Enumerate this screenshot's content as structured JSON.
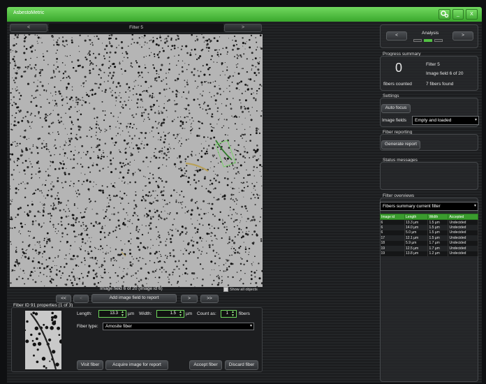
{
  "app": {
    "title": "AsbestoMetric",
    "minimize": "_",
    "close": "X"
  },
  "image_view": {
    "filter_label": "Filter 5",
    "prev": "<",
    "next": ">",
    "field_label": "Image field 6 of 20 (image id 6)",
    "show_all_objects": "Show all objects",
    "first": "<<",
    "back": "<",
    "add_field": "Add image field to report",
    "forward": ">",
    "last": ">>"
  },
  "fiber_properties": {
    "title": "Fiber ID 91 properties (1 of 3)",
    "length_label": "Length:",
    "length_value": "13.3",
    "length_unit": "µm",
    "width_label": "Width:",
    "width_value": "1.5",
    "width_unit": "µm",
    "count_label": "Count as:",
    "count_value": "1",
    "count_unit": "fibers",
    "type_label": "Fiber type:",
    "type_value": "Amosite fiber",
    "visit": "Visit fiber",
    "acquire": "Acquire image for report",
    "accept": "Accept fiber",
    "discard": "Discard fiber"
  },
  "analysis": {
    "label": "Analysis",
    "prev": "<",
    "next": ">"
  },
  "progress": {
    "title": "Progress summary",
    "count": "0",
    "count_label": "fibers counted",
    "filter": "Filter 5",
    "field": "Image field 6 of 20",
    "found": "7 fibers found"
  },
  "settings": {
    "title": "Settings",
    "auto_focus": "Auto focus",
    "fields_label": "Image fields",
    "fields_value": "Empty and loaded"
  },
  "reporting": {
    "title": "Fiber reporting",
    "generate": "Generate report"
  },
  "status": {
    "title": "Status messages"
  },
  "overviews": {
    "title": "Filter overviews",
    "select_value": "Fibers summary current filter",
    "columns": [
      "Image id",
      "Length",
      "Width",
      "Accepted"
    ],
    "rows": [
      [
        "6",
        "13.3 µm",
        "1.5 µm",
        "Undecided"
      ],
      [
        "6",
        "14.0 µm",
        "1.5 µm",
        "Undecided"
      ],
      [
        "6",
        "5.0 µm",
        "1.5 µm",
        "Undecided"
      ],
      [
        "17",
        "12.1 µm",
        "1.5 µm",
        "Undecided"
      ],
      [
        "18",
        "5.9 µm",
        "1.7 µm",
        "Undecided"
      ],
      [
        "19",
        "12.5 µm",
        "1.7 µm",
        "Undecided"
      ],
      [
        "19",
        "13.8 µm",
        "1.2 µm",
        "Undecided"
      ]
    ]
  }
}
